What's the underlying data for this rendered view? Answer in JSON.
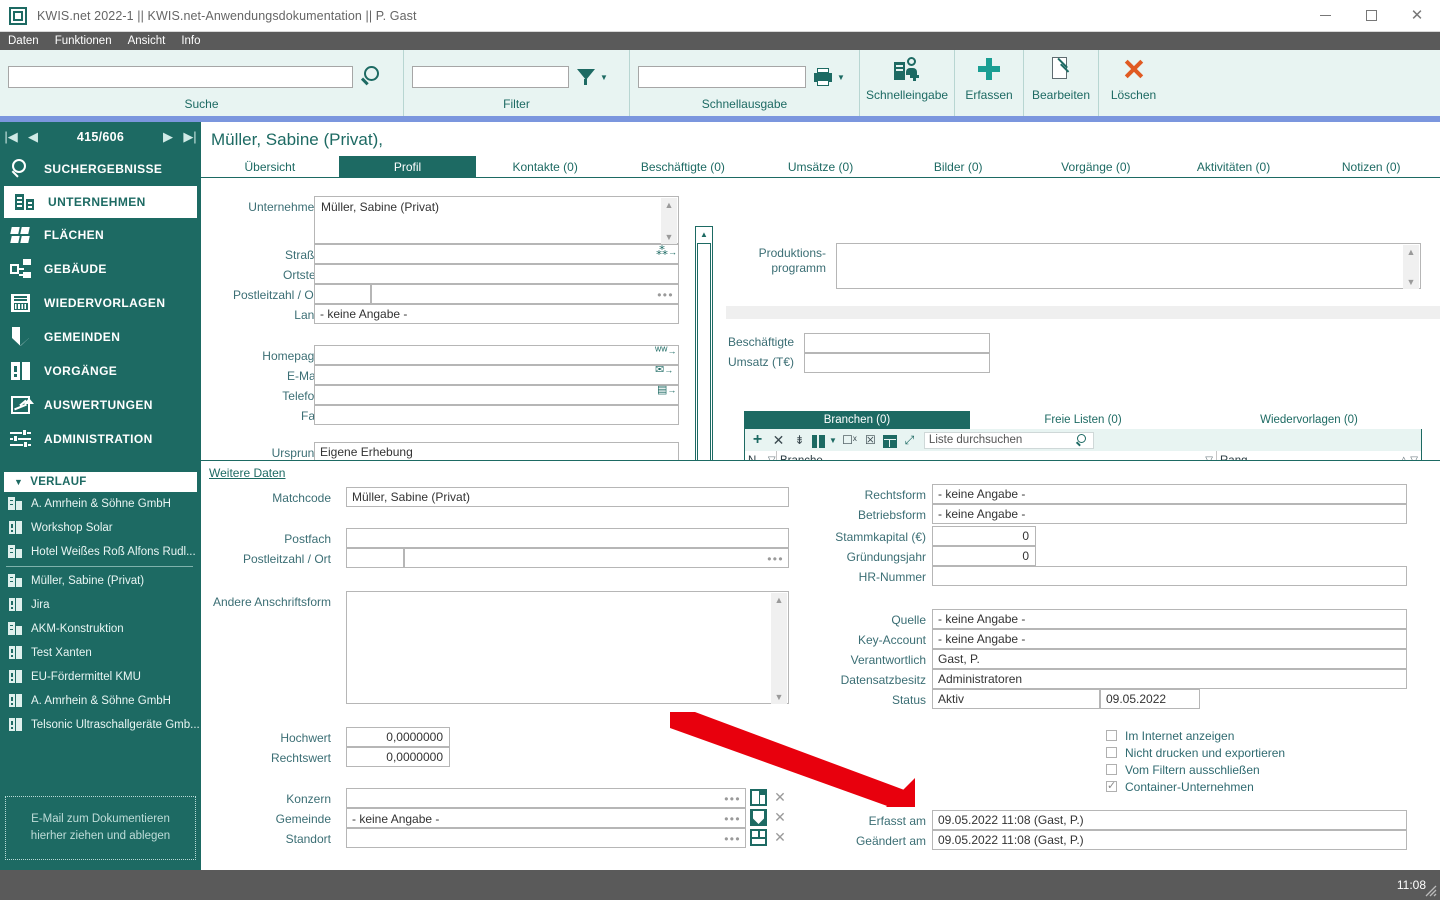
{
  "window": {
    "title": "KWIS.net 2022-1 || KWIS.net-Anwendungsdokumentation || P. Gast",
    "minimize": "—",
    "maximize": "▢",
    "close": "✕"
  },
  "menu": [
    "Daten",
    "Funktionen",
    "Ansicht",
    "Info"
  ],
  "ribbon": {
    "groups": [
      {
        "label": "Suche",
        "input_value": "",
        "icon": "magnifier-icon"
      },
      {
        "label": "Filter",
        "input_value": "",
        "icon": "funnel-icon"
      },
      {
        "label": "Schnellausgabe",
        "input_value": "",
        "icon": "printer-icon"
      }
    ],
    "buttons": [
      {
        "label": "Schnelleingabe",
        "icon": "quick-entry-icon"
      },
      {
        "label": "Erfassen",
        "icon": "plus-icon"
      },
      {
        "label": "Bearbeiten",
        "icon": "edit-pencil-icon"
      },
      {
        "label": "Löschen",
        "icon": "delete-x-icon"
      }
    ]
  },
  "sidebar": {
    "pager": {
      "first": "|◀",
      "prev": "◀",
      "count": "415/606",
      "next": "▶",
      "last": "▶|"
    },
    "items": [
      {
        "label": "SUCHERGEBNISSE",
        "icon": "search-icon",
        "selected": false
      },
      {
        "label": "UNTERNEHMEN",
        "icon": "company-icon",
        "selected": true
      },
      {
        "label": "FLÄCHEN",
        "icon": "areas-icon",
        "selected": false
      },
      {
        "label": "GEBÄUDE",
        "icon": "building-icon",
        "selected": false
      },
      {
        "label": "WIEDERVORLAGEN",
        "icon": "resubmission-icon",
        "selected": false
      },
      {
        "label": "GEMEINDEN",
        "icon": "shield-icon",
        "selected": false
      },
      {
        "label": "VORGÄNGE",
        "icon": "folder-icon",
        "selected": false
      },
      {
        "label": "AUSWERTUNGEN",
        "icon": "chart-icon",
        "selected": false
      },
      {
        "label": "ADMINISTRATION",
        "icon": "sliders-icon",
        "selected": false
      }
    ],
    "history": {
      "header": "VERLAUF",
      "collapse_glyph": "▼",
      "items": [
        {
          "label": "A. Amrhein & Söhne GmbH",
          "icon": "company-icon"
        },
        {
          "label": "Workshop Solar",
          "icon": "folder-icon"
        },
        {
          "label": "Hotel Weißes Roß Alfons Rudl...",
          "icon": "company-icon"
        },
        {
          "label": "Müller, Sabine (Privat)",
          "icon": "company-icon"
        },
        {
          "label": "Jira",
          "icon": "folder-icon"
        },
        {
          "label": "AKM-Konstruktion",
          "icon": "company-icon"
        },
        {
          "label": "Test Xanten",
          "icon": "folder-icon"
        },
        {
          "label": "EU-Fördermittel KMU",
          "icon": "folder-icon"
        },
        {
          "label": "A. Amrhein & Söhne GmbH",
          "icon": "folder-icon"
        },
        {
          "label": "Telsonic Ultraschallgeräte Gmb...",
          "icon": "folder-icon"
        }
      ]
    },
    "dropzone": {
      "line1": "E-Mail  zum Dokumentieren",
      "line2": "hierher ziehen und ablegen"
    }
  },
  "record": {
    "title": "Müller, Sabine (Privat),",
    "tabs": [
      {
        "label": "Übersicht",
        "active": false
      },
      {
        "label": "Profil",
        "active": true
      },
      {
        "label": "Kontakte (0)",
        "active": false
      },
      {
        "label": "Beschäftigte (0)",
        "active": false
      },
      {
        "label": "Umsätze (0)",
        "active": false
      },
      {
        "label": "Bilder (0)",
        "active": false
      },
      {
        "label": "Vorgänge (0)",
        "active": false
      },
      {
        "label": "Aktivitäten (0)",
        "active": false
      },
      {
        "label": "Notizen (0)",
        "active": false
      }
    ]
  },
  "profile_upper": {
    "left_fields": [
      {
        "label": "Unternehmen",
        "value": "Müller, Sabine (Privat)"
      },
      {
        "label": "Straße",
        "value": ""
      },
      {
        "label": "Ortsteil",
        "value": ""
      },
      {
        "label": "Postleitzahl / Ort",
        "value": "",
        "value2": ""
      },
      {
        "label": "Land",
        "value": "- keine Angabe -"
      },
      {
        "label": "Homepage",
        "value": ""
      },
      {
        "label": "E-Mail",
        "value": ""
      },
      {
        "label": "Telefon",
        "value": ""
      },
      {
        "label": "Fax",
        "value": ""
      },
      {
        "label": "Ursprung",
        "value": "Eigene Erhebung"
      }
    ],
    "right_fields": [
      {
        "label": "Produktions-\nprogramm",
        "value": ""
      },
      {
        "label": "Beschäftigte",
        "value": ""
      },
      {
        "label": "Umsatz (T€)",
        "value": ""
      }
    ]
  },
  "branchen": {
    "subtabs": [
      {
        "label": "Branchen (0)",
        "active": true
      },
      {
        "label": "Freie Listen (0)",
        "active": false
      },
      {
        "label": "Wiedervorlagen (0)",
        "active": false
      }
    ],
    "toolbar_icons": [
      "add-icon",
      "delete-icon",
      "sort-icon",
      "columns-icon",
      "export-word-icon",
      "export-excel-icon",
      "table-icon",
      "expand-icon"
    ],
    "search_placeholder": "Liste durchsuchen",
    "search_value": "",
    "columns": [
      {
        "label": "N…"
      },
      {
        "label": "Branche"
      },
      {
        "label": "Rang"
      }
    ]
  },
  "weitere": {
    "link": "Weitere Daten",
    "left_fields": [
      {
        "label": "Matchcode",
        "value": "Müller, Sabine (Privat)"
      },
      {
        "label": "Postfach",
        "value": ""
      },
      {
        "label": "Postleitzahl / Ort",
        "value": "",
        "value2": ""
      },
      {
        "label": "Andere Anschriftsform",
        "value": ""
      },
      {
        "label": "Hochwert",
        "value": "0,0000000"
      },
      {
        "label": "Rechtswert",
        "value": "0,0000000"
      },
      {
        "label": "Konzern",
        "value": "",
        "icon": "company-picker-icon"
      },
      {
        "label": "Gemeinde",
        "value": "- keine Angabe -",
        "icon": "shield-picker-icon"
      },
      {
        "label": "Standort",
        "value": "",
        "icon": "location-picker-icon"
      }
    ],
    "right_fields": [
      {
        "label": "Rechtsform",
        "value": "- keine Angabe -"
      },
      {
        "label": "Betriebsform",
        "value": "- keine Angabe -"
      },
      {
        "label": "Stammkapital (€)",
        "value": "0"
      },
      {
        "label": "Gründungsjahr",
        "value": "0"
      },
      {
        "label": "HR-Nummer",
        "value": ""
      },
      {
        "label": "Quelle",
        "value": "- keine Angabe -"
      },
      {
        "label": "Key-Account",
        "value": "- keine Angabe -"
      },
      {
        "label": "Verantwortlich",
        "value": "Gast, P."
      },
      {
        "label": "Datensatzbesitz",
        "value": "Administratoren"
      },
      {
        "label": "Status",
        "value": "Aktiv",
        "value2": "09.05.2022"
      }
    ],
    "checkboxes": [
      {
        "label": "Im Internet anzeigen",
        "checked": false
      },
      {
        "label": "Nicht drucken und exportieren",
        "checked": false
      },
      {
        "label": "Vom Filtern ausschließen",
        "checked": false
      },
      {
        "label": "Container-Unternehmen",
        "checked": true
      }
    ],
    "audit": [
      {
        "label": "Erfasst am",
        "value": "09.05.2022 11:08 (Gast, P.)"
      },
      {
        "label": "Geändert am",
        "value": "09.05.2022 11:08 (Gast, P.)"
      }
    ]
  },
  "annotation": {
    "arrow_color": "#e8000d",
    "points_to": "Container-Unternehmen"
  },
  "statusbar": {
    "time": "11:08"
  },
  "colors": {
    "accent": "#1d6a63",
    "ribbon_bg": "#e8f4f2",
    "accent_bar": "#7b96de",
    "chrome": "#5a5a5a"
  }
}
